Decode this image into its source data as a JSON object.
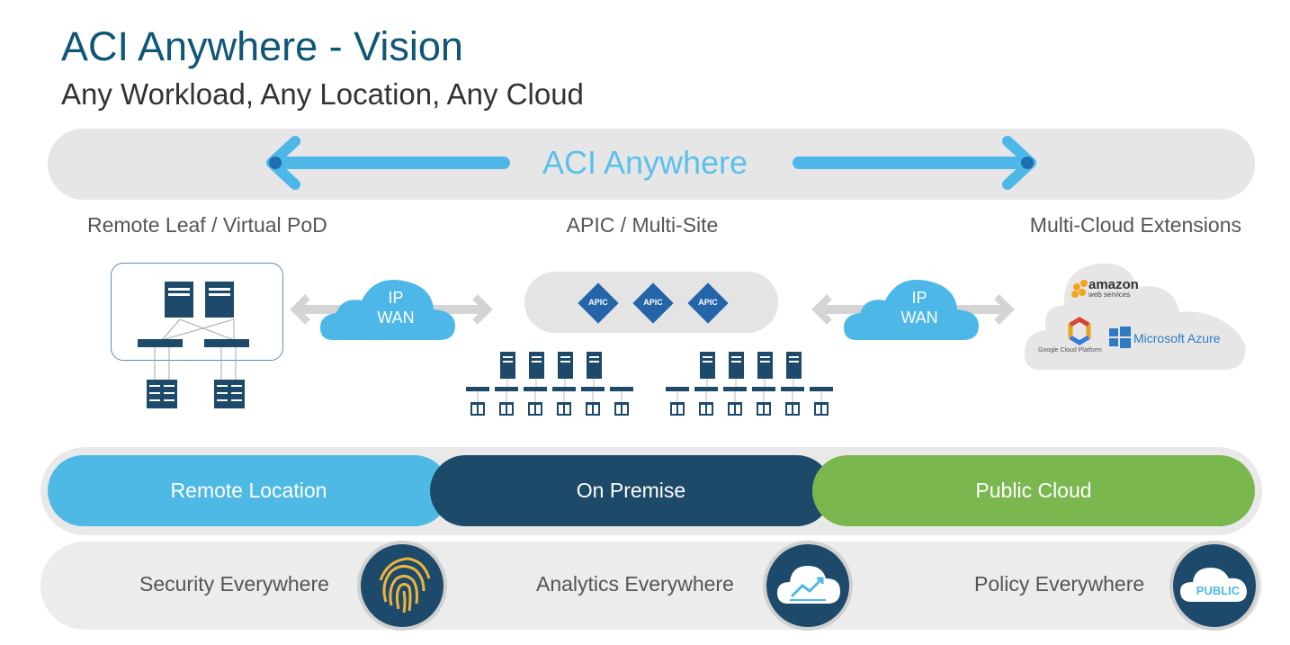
{
  "title": "ACI Anywhere - Vision",
  "subtitle": "Any Workload, Any Location, Any Cloud",
  "banner": {
    "label": "ACI Anywhere"
  },
  "sections": {
    "left": "Remote Leaf / Virtual PoD",
    "center": "APIC / Multi-Site",
    "right": "Multi-Cloud Extensions"
  },
  "wan_clouds": [
    {
      "line1": "IP",
      "line2": "WAN"
    },
    {
      "line1": "IP",
      "line2": "WAN"
    }
  ],
  "apic_label": "APIC",
  "cloud_providers": {
    "amazon": "amazon",
    "amazon_sub": "web services",
    "google": "Google Cloud Platform",
    "azure": "Microsoft Azure"
  },
  "locations": [
    {
      "label": "Remote Location",
      "color": "#4fb9e6"
    },
    {
      "label": "On Premise",
      "color": "#1e4a6a"
    },
    {
      "label": "Public Cloud",
      "color": "#7ab84f"
    }
  ],
  "capabilities": [
    {
      "label": "Security Everywhere",
      "icon": "fingerprint-icon"
    },
    {
      "label": "Analytics Everywhere",
      "icon": "analytics-cloud-icon"
    },
    {
      "label": "Policy Everywhere",
      "icon": "public-cloud-icon",
      "badge": "PUBLIC"
    }
  ],
  "colors": {
    "title": "#0f5677",
    "accent": "#4db8e8",
    "dark": "#1d4a6a",
    "green": "#7ab84f"
  }
}
